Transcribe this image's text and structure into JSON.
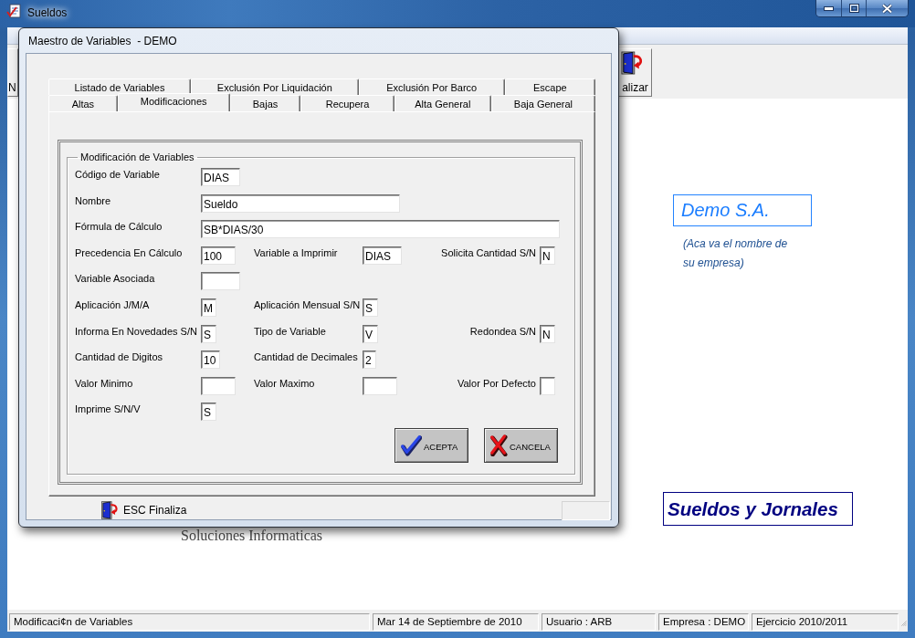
{
  "main_window": {
    "title": "Sueldos"
  },
  "toolbar": {
    "buttons": [
      {
        "label": "N"
      },
      {
        "label": "alizar"
      }
    ]
  },
  "workspace": {
    "company_name": "Demo S.A.",
    "company_note": "(Aca va el nombre de su empresa)",
    "vendor": "Soluciones Informaticas",
    "product": "Sueldos y Jornales"
  },
  "status_bar": {
    "panels": [
      "Modificaci¢n de Variables",
      "Mar 14 de Septiembre de 2010",
      "Usuario : ARB",
      "Empresa : DEMO",
      "Ejercicio 2010/2011"
    ]
  },
  "dialog": {
    "title": "Maestro de Variables  - DEMO",
    "tab_rows": [
      [
        {
          "label": "Listado de Variables",
          "selected": false
        },
        {
          "label": "Exclusión Por Liquidación",
          "selected": false
        },
        {
          "label": "Exclusión Por Barco",
          "selected": false
        },
        {
          "label": "Escape",
          "selected": false
        }
      ],
      [
        {
          "label": "Altas",
          "selected": false
        },
        {
          "label": "Modificaciones",
          "selected": true
        },
        {
          "label": "Bajas",
          "selected": false
        },
        {
          "label": "Recupera",
          "selected": false
        },
        {
          "label": "Alta General",
          "selected": false
        },
        {
          "label": "Baja General",
          "selected": false
        }
      ]
    ],
    "group": {
      "legend": "Modificación de Variables",
      "rows": [
        [
          {
            "label": "Código de Variable",
            "value": "DIAS"
          }
        ],
        [
          {
            "label": "Nombre",
            "value": "Sueldo"
          }
        ],
        [
          {
            "label": "Fórmula de Cálculo",
            "value": "SB*DIAS/30"
          }
        ],
        [
          {
            "label": "Precedencia En Cálculo",
            "value": "100"
          },
          {
            "label": "Variable a Imprimir",
            "value": "DIAS"
          },
          {
            "label": "Solicita Cantidad S/N",
            "value": "N"
          }
        ],
        [
          {
            "label": "Variable Asociada"
          }
        ],
        [
          {
            "label": "Aplicación J/M/A",
            "value": "M"
          },
          {
            "label": "Aplicación Mensual S/N",
            "value": "S"
          }
        ],
        [
          {
            "label": "Informa En Novedades S/N",
            "value": "S"
          },
          {
            "label": "Tipo de Variable",
            "value": "V"
          },
          {
            "label": "Redondea S/N",
            "value": "N"
          }
        ],
        [
          {
            "label": "Cantidad de Digitos",
            "value": "10"
          },
          {
            "label": "Cantidad de Decimales",
            "value": "2"
          }
        ],
        [
          {
            "label": "Valor Minimo"
          },
          {
            "label": "Valor Maximo"
          },
          {
            "label": "Valor Por Defecto"
          }
        ],
        [
          {
            "label": "Imprime S/N/V",
            "value": "S"
          }
        ]
      ]
    },
    "buttons": [
      {
        "kind": "accept",
        "label": "ACEPTA"
      },
      {
        "kind": "cancel",
        "label": "CANCELA"
      }
    ],
    "footer_hint": "ESC Finaliza"
  }
}
